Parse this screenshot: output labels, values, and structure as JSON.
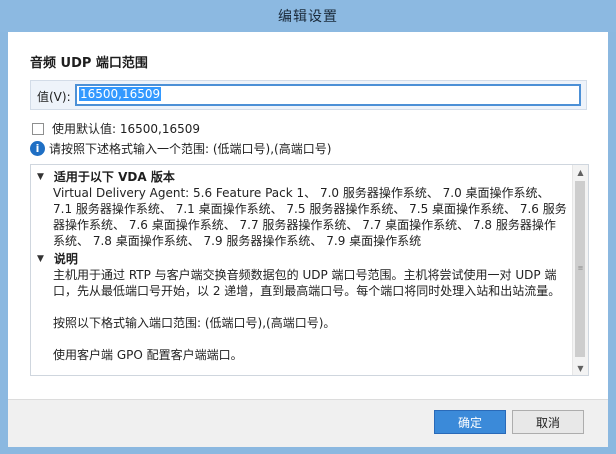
{
  "window": {
    "title": "编辑设置"
  },
  "setting": {
    "title": "音频 UDP 端口范围"
  },
  "value": {
    "label": "值(V):",
    "input_value": "16500,16509"
  },
  "default": {
    "label": "使用默认值: 16500,16509",
    "checked": false
  },
  "info": {
    "text": "请按照下述格式输入一个范围: (低端口号),(高端口号)"
  },
  "details": {
    "applies": {
      "heading": "适用于以下 VDA 版本",
      "text": "Virtual Delivery Agent: 5.6 Feature Pack 1、 7.0 服务器操作系统、 7.0 桌面操作系统、 7.1 服务器操作系统、 7.1 桌面操作系统、 7.5 服务器操作系统、 7.5 桌面操作系统、 7.6 服务器操作系统、 7.6 桌面操作系统、 7.7 服务器操作系统、 7.7 桌面操作系统、 7.8 服务器操作系统、 7.8 桌面操作系统、 7.9 服务器操作系统、 7.9 桌面操作系统"
    },
    "description": {
      "heading": "说明",
      "para1": "主机用于通过 RTP 与客户端交换音频数据包的 UDP 端口号范围。主机将尝试使用一对 UDP 端口，先从最低端口号开始，以 2 递增，直到最高端口号。每个端口将同时处理入站和出站流量。",
      "para2": "按照以下格式输入端口范围: (低端口号),(高端口号)。",
      "para3": "使用客户端 GPO 配置客户端端口。"
    }
  },
  "buttons": {
    "ok": "确定",
    "cancel": "取消"
  },
  "colors": {
    "titlebar": "#8cb9e1",
    "accent": "#3b8ad9",
    "selection": "#3399ff"
  }
}
